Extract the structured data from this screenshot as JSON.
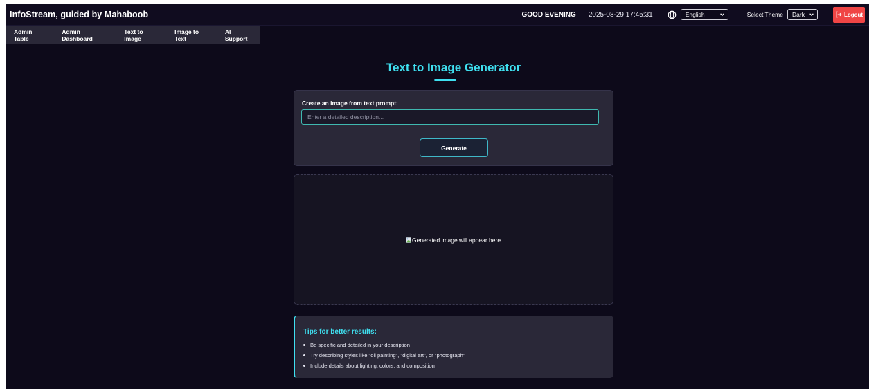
{
  "header": {
    "brand": "InfoStream, guided by Mahaboob",
    "greeting": "GOOD EVENING",
    "datetime": "2025-08-29 17:45:31",
    "language": {
      "selected": "English"
    },
    "theme": {
      "label": "Select Theme",
      "selected": "Dark"
    },
    "logout_label": "Logout"
  },
  "nav": {
    "items": [
      {
        "label": "Admin Table"
      },
      {
        "label": "Admin Dashboard"
      },
      {
        "label": "Text to Image"
      },
      {
        "label": "Image to Text"
      },
      {
        "label": "AI Support"
      }
    ],
    "active": "Text to Image"
  },
  "main": {
    "title": "Text to Image Generator",
    "prompt": {
      "label": "Create an image from text prompt:",
      "placeholder": "Enter a detailed description...",
      "value": ""
    },
    "generate_label": "Generate",
    "preview_alt": "Generated image will appear here",
    "tips": {
      "title": "Tips for better results:",
      "items": [
        "Be specific and detailed in your description",
        "Try describing styles like \"oil painting\", \"digital art\", or \"photograph\"",
        "Include details about lighting, colors, and composition"
      ]
    }
  },
  "colors": {
    "background": "#0d0a1a",
    "accent": "#3fe0f0",
    "card": "#2a2838",
    "logout": "#f04545"
  },
  "icons": {
    "globe": "globe-icon",
    "chevron": "chevron-down-icon",
    "logout": "logout-icon",
    "broken_image": "broken-image-icon"
  }
}
